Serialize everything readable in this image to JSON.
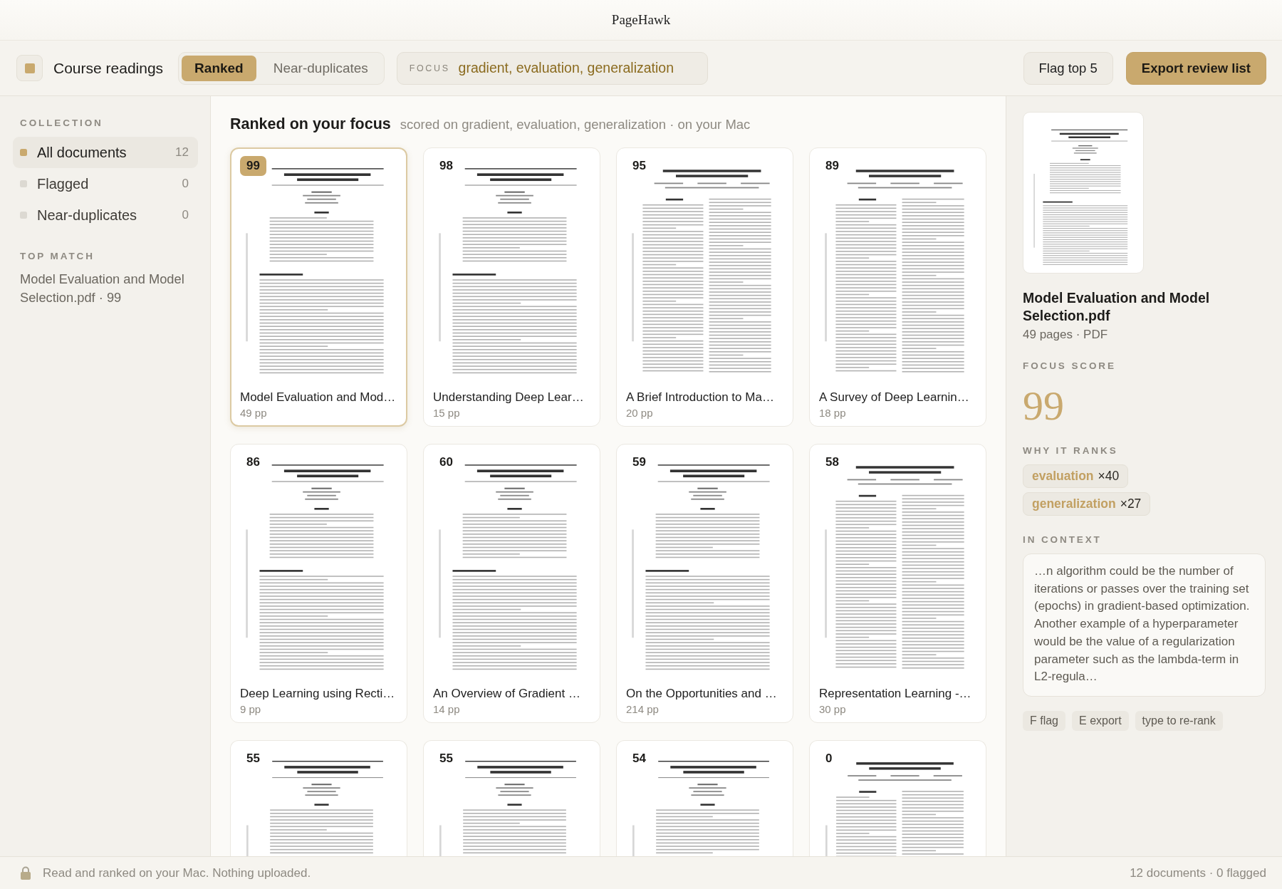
{
  "window": {
    "title": "PageHawk"
  },
  "toolbar": {
    "collection": "Course readings",
    "views": [
      {
        "label": "Ranked",
        "selected": true
      },
      {
        "label": "Near-duplicates",
        "selected": false
      }
    ],
    "focus": {
      "label": "FOCUS",
      "value": "gradient, evaluation, generalization"
    },
    "actions": [
      {
        "label": "Flag top 5",
        "kind": "secondary"
      },
      {
        "label": "Export review list",
        "kind": "primary"
      }
    ]
  },
  "sidebar": {
    "collection": {
      "heading": "COLLECTION",
      "items": [
        {
          "label": "All documents",
          "count": "12",
          "selected": true
        },
        {
          "label": "Flagged",
          "count": "0",
          "selected": false
        },
        {
          "label": "Near-duplicates",
          "count": "0",
          "selected": false
        }
      ]
    },
    "top_match": {
      "heading": "TOP MATCH",
      "text": "Model Evaluation and Model Selection.pdf · 99"
    }
  },
  "results": {
    "heading": "Ranked on your focus",
    "subheading": "scored on gradient, evaluation, generalization · on your Mac",
    "documents": [
      {
        "kind": "single",
        "score": "99",
        "title": "Model Evaluation and Mod…",
        "pages": "49 pp",
        "selected": true
      },
      {
        "kind": "single",
        "score": "98",
        "title": "Understanding Deep Lear…",
        "pages": "15 pp",
        "selected": false
      },
      {
        "kind": "columns",
        "score": "95",
        "title": "A Brief Introduction to Ma…",
        "pages": "20 pp",
        "selected": false
      },
      {
        "kind": "columns",
        "score": "89",
        "title": "A Survey of Deep Learnin…",
        "pages": "18 pp",
        "selected": false
      },
      {
        "kind": "single",
        "score": "86",
        "title": "Deep Learning using Recti…",
        "pages": "9 pp",
        "selected": false
      },
      {
        "kind": "single",
        "score": "60",
        "title": "An Overview of Gradient …",
        "pages": "14 pp",
        "selected": false
      },
      {
        "kind": "single",
        "score": "59",
        "title": "On the Opportunities and …",
        "pages": "214 pp",
        "selected": false
      },
      {
        "kind": "columns",
        "score": "58",
        "title": "Representation Learning -…",
        "pages": "30 pp",
        "selected": false
      },
      {
        "kind": "single",
        "score": "55",
        "selected": false
      },
      {
        "kind": "single",
        "score": "55",
        "selected": false
      },
      {
        "kind": "single",
        "score": "54",
        "selected": false
      },
      {
        "kind": "columns",
        "score": "0",
        "selected": false
      }
    ]
  },
  "detail": {
    "title": "Model Evaluation and Model Selection.pdf",
    "meta": "49 pages · PDF",
    "score_heading": "FOCUS SCORE",
    "score": "99",
    "reasons_heading": "WHY IT RANKS",
    "reasons": [
      {
        "term": "evaluation",
        "count": "×40"
      },
      {
        "term": "generalization",
        "count": "×27"
      }
    ],
    "context_heading": "IN CONTEXT",
    "context": "…n algorithm could be the number of iterations or passes over the training set (epochs) in gradient-based optimization. Another example of a hyperparameter would be the value of a regularization parameter such as the lambda-term in L2-regula…",
    "shortcuts": [
      "F flag",
      "E export",
      "type to re-rank"
    ]
  },
  "status_bar": {
    "left": "Read and ranked on your Mac. Nothing uploaded.",
    "right": "12 documents · 0 flagged"
  }
}
